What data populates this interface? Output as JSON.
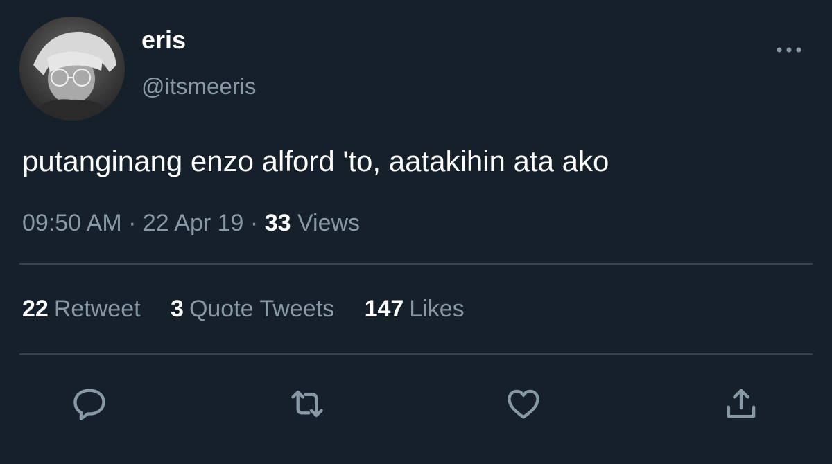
{
  "author": {
    "display_name": "eris",
    "handle": "@itsmeeris"
  },
  "tweet": {
    "text": "putanginang enzo alford 'to, aatakihin ata ako"
  },
  "meta": {
    "time": "09:50 AM",
    "separator": "·",
    "date": "22 Apr 19",
    "views_count": "33",
    "views_label": "Views"
  },
  "stats": {
    "retweets_count": "22",
    "retweets_label": "Retweet",
    "quotes_count": "3",
    "quotes_label": "Quote Tweets",
    "likes_count": "147",
    "likes_label": "Likes"
  },
  "actions": {
    "reply_icon": "reply-icon",
    "retweet_icon": "retweet-icon",
    "like_icon": "heart-icon",
    "share_icon": "share-icon"
  },
  "colors": {
    "background": "#15202b",
    "secondary_text": "#8899a6",
    "divider": "#38444d",
    "icon": "#8899a6"
  }
}
